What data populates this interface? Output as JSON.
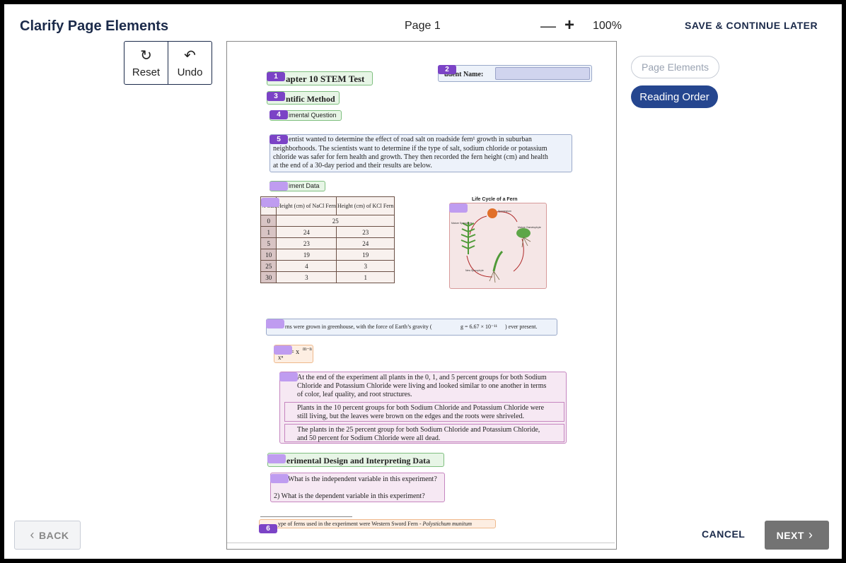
{
  "header": {
    "title": "Clarify Page Elements",
    "page_label": "Page 1",
    "zoom_out": "—",
    "zoom_in": "+",
    "zoom_level": "100%",
    "save_later": "SAVE & CONTINUE LATER"
  },
  "tools": {
    "reset": "Reset",
    "undo": "Undo",
    "reset_icon": "↻",
    "undo_icon": "↶"
  },
  "modes": {
    "page_elements": "Page Elements",
    "reading_order": "Reading Order"
  },
  "footer": {
    "back": "BACK",
    "cancel": "CANCEL",
    "next": "NEXT",
    "back_chevron": "‹",
    "next_chevron": "›"
  },
  "doc": {
    "badges": [
      "1",
      "2",
      "3",
      "4",
      "5",
      "6"
    ],
    "title_text": "apter 10 STEM Test",
    "student_name": "udent Name:",
    "method": "ntific Method",
    "question": "imental Question",
    "para_lines": [
      "entist wanted to determine the effect of road salt on roadside fern¹ growth in suburban",
      "neighborhoods. The scientists want to determine if the type of salt, sodium chloride or potassium",
      "chloride was safer for fern health and growth. They then recorded the fern height (cm) and health",
      "at the end of a 30-day period and their results are below."
    ],
    "data_label": "iment Data",
    "table_headers": [
      "% Salt",
      "Height (cm) of NaCl Fern",
      "Height (cm) of KCl Fern"
    ],
    "table_rows": [
      [
        "0",
        "25"
      ],
      [
        "1",
        "24",
        "23"
      ],
      [
        "5",
        "23",
        "24"
      ],
      [
        "10",
        "19",
        "19"
      ],
      [
        "25",
        "4",
        "3"
      ],
      [
        "30",
        "3",
        "1"
      ]
    ],
    "figure_title": "Life Cycle of a Fern",
    "figure_labels": [
      "Sporangium",
      "Mature Sporophyte",
      "Mature Gametophyte",
      "New Sporophyte"
    ],
    "greenhouse": "rns were grown in greenhouse, with the  force of Earth’s gravity (",
    "gravity_value": "g = 6.67 × 10⁻¹¹",
    "greenhouse_end": ") ever present.",
    "formula_top": "= x",
    "formula_exp": "m−n",
    "formula_bottom": "xⁿ",
    "list_lines": [
      "At the end of the experiment all plants in the 0, 1, and 5 percent groups for both Sodium",
      "Chloride and Potassium Chloride were living and looked similar to one another in terms",
      "of color, leaf quality, and root structures.",
      "Plants in the 10 percent groups for both Sodium Chloride and Potassium Chloride were",
      "still living, but the leaves were brown on the edges and the roots were shriveled.",
      "The plants in the 25 percent group for both Sodium Chloride and Potassium Chloride,",
      "and 50 percent for Sodium Chloride were all dead."
    ],
    "design_heading": "erimental Design and Interpreting Data",
    "q1": "What is the independent variable in this experiment?",
    "q2": "2)   What is the dependent variable in this experiment?",
    "footnote": "ype of ferns used in the experiment were Western Sword Fern - ",
    "footnote_italic": "Polystichum munitum"
  }
}
